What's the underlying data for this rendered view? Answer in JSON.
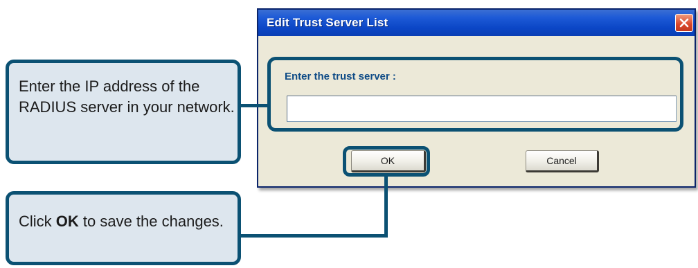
{
  "dialog": {
    "title": "Edit Trust Server List",
    "close_icon": "close-icon",
    "label": "Enter the trust server :",
    "input_value": "",
    "ok_label": "OK",
    "cancel_label": "Cancel"
  },
  "callouts": {
    "ip_text": "Enter the IP address of the RADIUS server in your network.",
    "ok_prefix": "Click ",
    "ok_bold": "OK",
    "ok_suffix": " to save the changes."
  },
  "colors": {
    "titlebar": "#0b46c6",
    "highlight": "#0b5173",
    "callout_bg": "#dde6ee",
    "label_text": "#0e4b86",
    "dialog_bg": "#ece9d8"
  }
}
